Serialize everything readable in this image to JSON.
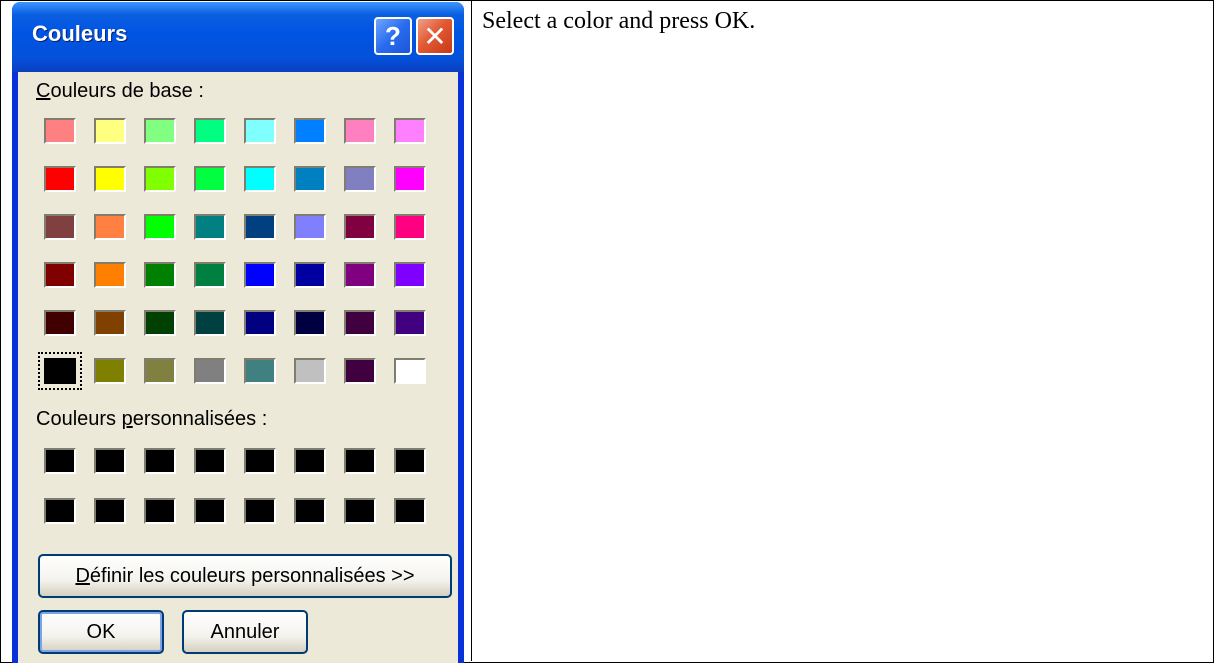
{
  "instruction": "Select a color and press OK.",
  "dialog": {
    "title": "Couleurs",
    "help_icon": "question-mark-icon",
    "close_icon": "close-x-icon",
    "help_glyph": "?",
    "close_glyph": "✕",
    "basic_label_first": "C",
    "basic_label_rest": "ouleurs de base :",
    "custom_label_first": "Couleurs ",
    "custom_label_underlined": "p",
    "custom_label_rest": "ersonnalisées :",
    "define_button": {
      "underlined": "D",
      "rest": "éfinir les couleurs personnalisées >>"
    },
    "ok_button": "OK",
    "cancel_button": "Annuler",
    "selected_color": "#000000",
    "basic_colors": [
      "#ff8080",
      "#ffff80",
      "#80ff80",
      "#00ff80",
      "#80ffff",
      "#0080ff",
      "#ff80c0",
      "#ff80ff",
      "#ff0000",
      "#ffff00",
      "#80ff00",
      "#00ff40",
      "#00ffff",
      "#0080c0",
      "#8080c0",
      "#ff00ff",
      "#804040",
      "#ff8040",
      "#00ff00",
      "#008080",
      "#004080",
      "#8080ff",
      "#800040",
      "#ff0080",
      "#800000",
      "#ff8000",
      "#008000",
      "#008040",
      "#0000ff",
      "#0000a0",
      "#800080",
      "#8000ff",
      "#400000",
      "#804000",
      "#004000",
      "#004040",
      "#000080",
      "#000040",
      "#400040",
      "#400080",
      "#000000",
      "#808000",
      "#808040",
      "#808080",
      "#408080",
      "#c0c0c0",
      "#400040",
      "#ffffff"
    ],
    "custom_colors": [
      "#000000",
      "#000000",
      "#000000",
      "#000000",
      "#000000",
      "#000000",
      "#000000",
      "#000000",
      "#000000",
      "#000000",
      "#000000",
      "#000000",
      "#000000",
      "#000000",
      "#000000",
      "#000000"
    ]
  }
}
